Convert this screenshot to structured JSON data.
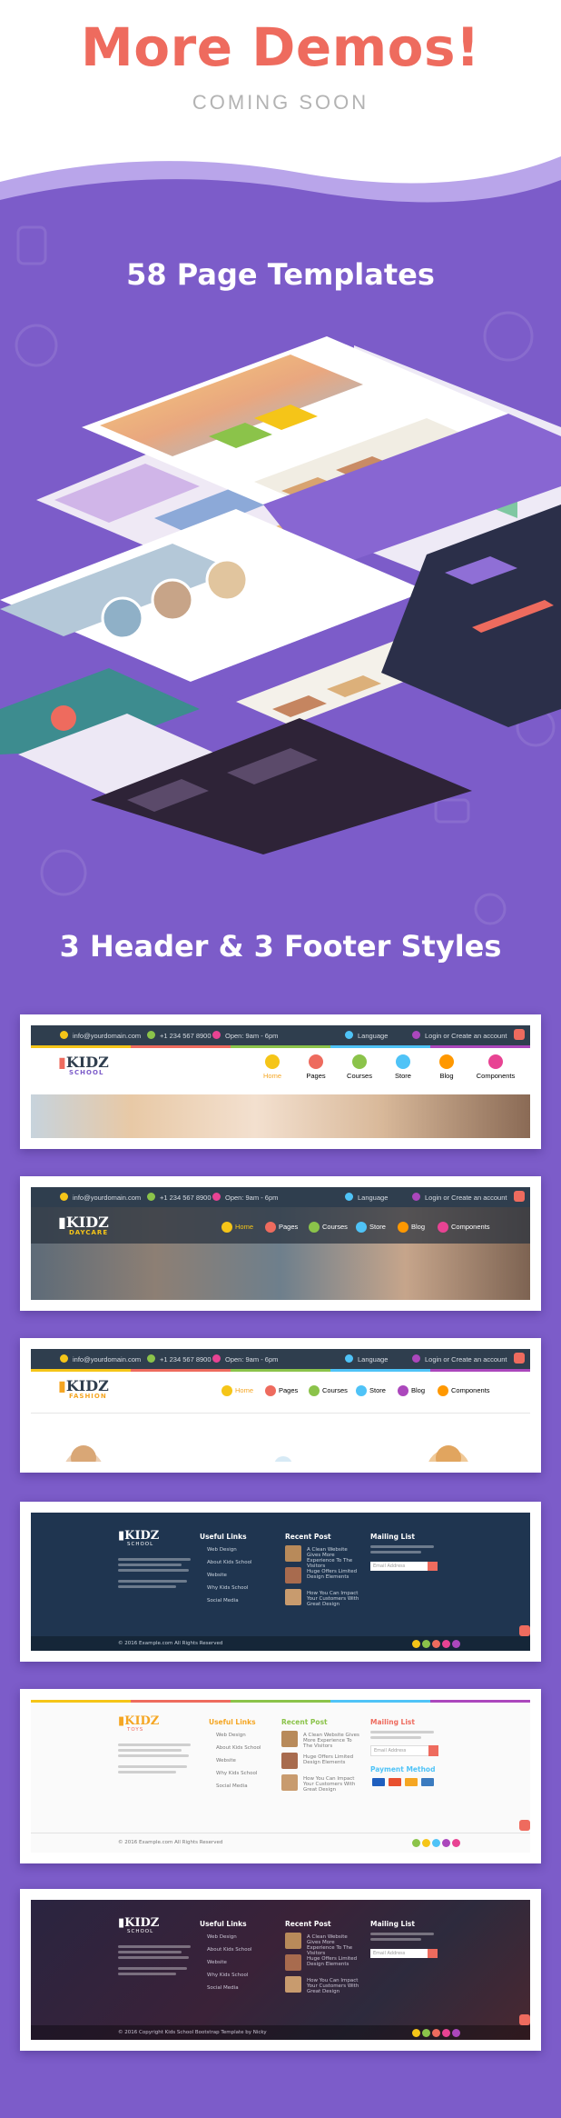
{
  "hero": {
    "title": "More Demos!",
    "subtitle": "COMING SOON"
  },
  "sections": {
    "templates_title": "58 Page Templates",
    "headers_title": "3 Header & 3 Footer Styles"
  },
  "headers": [
    {
      "email": "info@yourdomain.com",
      "phone": "+1 234 567 8900",
      "hours": "Open: 9am - 6pm",
      "language": "Language",
      "login": "Login or Create an account",
      "logo_main": "KIDZ",
      "logo_sub": "SCHOOL",
      "nav": [
        "Home",
        "Pages",
        "Courses",
        "Store",
        "Blog",
        "Components"
      ]
    },
    {
      "email": "info@yourdomain.com",
      "phone": "+1 234 567 8900",
      "hours": "Open: 9am - 6pm",
      "language": "Language",
      "login": "Login or Create an account",
      "logo_main": "KIDZ",
      "logo_sub": "DAYCARE",
      "nav": [
        "Home",
        "Pages",
        "Courses",
        "Store",
        "Blog",
        "Components"
      ]
    },
    {
      "email": "info@yourdomain.com",
      "phone": "+1 234 567 8900",
      "hours": "Open: 9am - 6pm",
      "language": "Language",
      "login": "Login or Create an account",
      "logo_main": "KIDZ",
      "logo_sub": "FASHION",
      "nav": [
        "Home",
        "Pages",
        "Courses",
        "Store",
        "Blog",
        "Components"
      ]
    }
  ],
  "footers": [
    {
      "logo_main": "KIDZ",
      "logo_sub": "SCHOOL",
      "useful_links_title": "Useful Links",
      "links": [
        "Web Design",
        "About Kids School",
        "Website",
        "Why Kids School",
        "Social Media"
      ],
      "recent_post_title": "Recent Post",
      "posts": [
        "A Clean Website Gives More Experience To The Visitors",
        "Huge Offers Limited Design Elements",
        "How You Can Impact Your Customers With Great Design"
      ],
      "mailing_title": "Mailing List",
      "email_placeholder": "Email Address",
      "copyright": "© 2016 Example.com All Rights Reserved"
    },
    {
      "logo_main": "KIDZ",
      "logo_sub": "TOYS",
      "useful_links_title": "Useful Links",
      "links": [
        "Web Design",
        "About Kids School",
        "Website",
        "Why Kids School",
        "Social Media"
      ],
      "recent_post_title": "Recent Post",
      "posts": [
        "A Clean Website Gives More Experience To The Visitors",
        "Huge Offers Limited Design Elements",
        "How You Can Impact Your Customers With Great Design"
      ],
      "mailing_title": "Mailing List",
      "email_placeholder": "Email Address",
      "payment_title": "Payment Method",
      "copyright": "© 2016 Example.com All Rights Reserved"
    },
    {
      "logo_main": "KIDZ",
      "logo_sub": "SCHOOL",
      "useful_links_title": "Useful Links",
      "links": [
        "Web Design",
        "About Kids School",
        "Website",
        "Why Kids School",
        "Social Media"
      ],
      "recent_post_title": "Recent Post",
      "posts": [
        "A Clean Website Gives More Experience To The Visitors",
        "Huge Offers Limited Design Elements",
        "How You Can Impact Your Customers With Great Design"
      ],
      "mailing_title": "Mailing List",
      "email_placeholder": "Email Address",
      "copyright": "© 2016 Copyright Kids School Bootstrap Template by Nicky"
    }
  ],
  "colors": {
    "title_coral": "#ee6b5e",
    "purple_bg": "#7c5cc9",
    "topbar_navy": "#2f3e4e",
    "footer_navy": "#1f3550",
    "footer_dark": "#2b2233",
    "nav_yellow": "#f5c518",
    "nav_red": "#ee6b5e",
    "nav_green": "#8bc34a",
    "nav_blue": "#4fc3f7",
    "nav_orange": "#ff9800",
    "nav_pink": "#e84393"
  },
  "icons": [
    "envelope-icon",
    "phone-icon",
    "clock-icon",
    "globe-icon",
    "lock-icon",
    "cart-icon",
    "scroll-top-icon"
  ]
}
